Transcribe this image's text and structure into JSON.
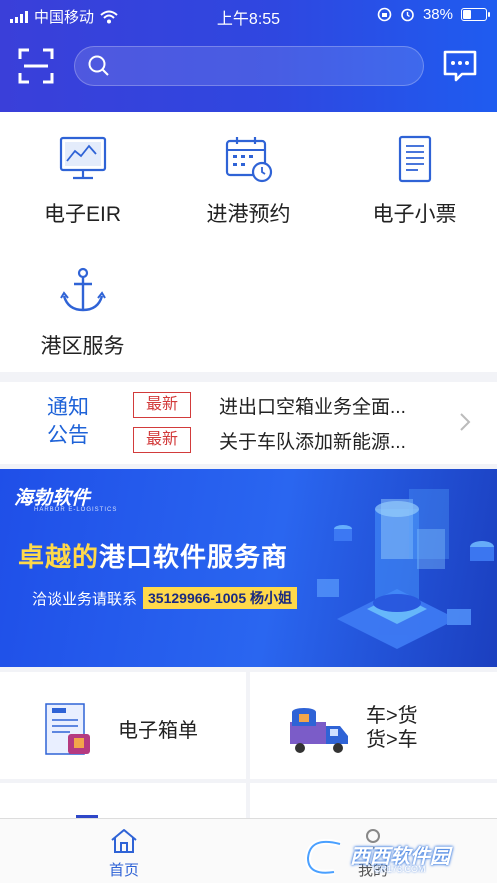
{
  "statusbar": {
    "carrier": "中国移动",
    "time": "上午8:55",
    "battery": "38%",
    "battery_level": 0.38
  },
  "header": {
    "search_placeholder": "",
    "scan_icon": "scan-icon",
    "message_icon": "message-icon"
  },
  "grid": {
    "items": [
      {
        "label": "电子EIR",
        "icon": "monitor-chart-icon"
      },
      {
        "label": "进港预约",
        "icon": "calendar-clock-icon"
      },
      {
        "label": "电子小票",
        "icon": "receipt-icon"
      },
      {
        "label": "港区服务",
        "icon": "anchor-icon"
      }
    ]
  },
  "notice": {
    "title": "通知公告",
    "rows": [
      {
        "tag": "最新",
        "text": "进出口空箱业务全面..."
      },
      {
        "tag": "最新",
        "text": "关于车队添加新能源..."
      }
    ]
  },
  "banner": {
    "logo": "海勃软件",
    "logo_sub": "HARBOR E-LOGISTICS",
    "title_highlight": "卓越的",
    "title_rest": "港口软件服务商",
    "contact_label": "洽谈业务请联系",
    "contact_phone": "35129966-1005 杨小姐"
  },
  "services": [
    {
      "label": "电子箱单",
      "icon": "document-box-icon"
    },
    {
      "label_line1": "车>货",
      "label_line2": "货>车",
      "icon": "truck-cargo-icon"
    }
  ],
  "tabbar": {
    "tabs": [
      {
        "label": "首页",
        "icon": "home-icon",
        "active": true
      },
      {
        "label": "我的",
        "icon": "user-icon",
        "active": false
      }
    ]
  },
  "watermark": {
    "text": "西西软件园",
    "sub": "CR173.COM"
  },
  "colors": {
    "primary": "#2f47e0",
    "notice_blue": "#1f63d8",
    "tag_red": "#d23b3b",
    "highlight_yellow": "#ffd94a"
  }
}
